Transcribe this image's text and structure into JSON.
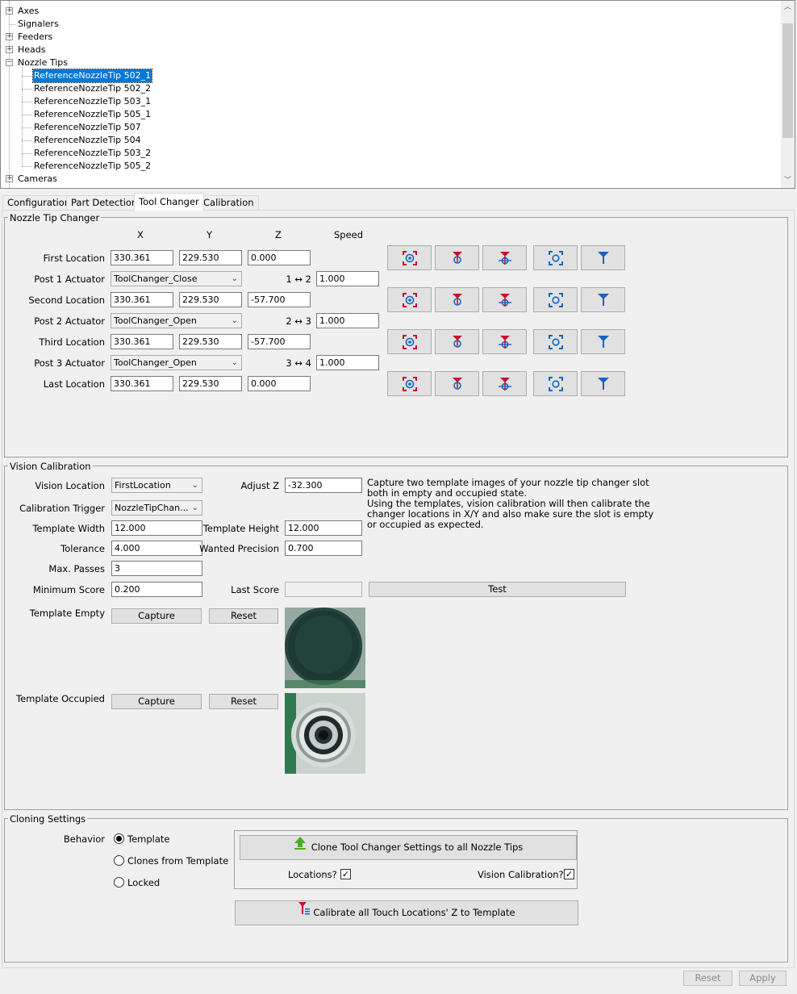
{
  "tree": {
    "items": [
      {
        "label": "Axes",
        "expander": "+"
      },
      {
        "label": "Signalers",
        "expander": ""
      },
      {
        "label": "Feeders",
        "expander": "+"
      },
      {
        "label": "Heads",
        "expander": "+"
      },
      {
        "label": "Nozzle Tips",
        "expander": "−"
      },
      {
        "label": "ReferenceNozzleTip 502_1",
        "expander": "",
        "selected": true
      },
      {
        "label": "ReferenceNozzleTip 502_2",
        "expander": ""
      },
      {
        "label": "ReferenceNozzleTip 503_1",
        "expander": ""
      },
      {
        "label": "ReferenceNozzleTip 505_1",
        "expander": ""
      },
      {
        "label": "ReferenceNozzleTip 507",
        "expander": ""
      },
      {
        "label": "ReferenceNozzleTip 504",
        "expander": ""
      },
      {
        "label": "ReferenceNozzleTip 503_2",
        "expander": ""
      },
      {
        "label": "ReferenceNozzleTip 505_2",
        "expander": ""
      },
      {
        "label": "Cameras",
        "expander": "+"
      }
    ]
  },
  "tabs": [
    {
      "label": "Configuration"
    },
    {
      "label": "Part Detection"
    },
    {
      "label": "Tool Changer",
      "active": true
    },
    {
      "label": "Calibration"
    }
  ],
  "changer": {
    "title": "Nozzle Tip Changer",
    "col_x": "X",
    "col_y": "Y",
    "col_z": "Z",
    "col_speed": "Speed",
    "rows": {
      "first": {
        "label": "First Location",
        "x": "330.361",
        "y": "229.530",
        "z": "0.000"
      },
      "post1": {
        "label": "Post 1 Actuator",
        "actuator": "ToolChanger_Close",
        "speed_label": "1 ↔ 2",
        "speed": "1.000"
      },
      "second": {
        "label": "Second Location",
        "x": "330.361",
        "y": "229.530",
        "z": "-57.700"
      },
      "post2": {
        "label": "Post 2 Actuator",
        "actuator": "ToolChanger_Open",
        "speed_label": "2 ↔ 3",
        "speed": "1.000"
      },
      "third": {
        "label": "Third Location",
        "x": "330.361",
        "y": "229.530",
        "z": "-57.700"
      },
      "post3": {
        "label": "Post 3 Actuator",
        "actuator": "ToolChanger_Open",
        "speed_label": "3 ↔ 4",
        "speed": "1.000"
      },
      "last": {
        "label": "Last Location",
        "x": "330.361",
        "y": "229.530",
        "z": "0.000"
      }
    }
  },
  "vision": {
    "title": "Vision Calibration",
    "vision_location_label": "Vision Location",
    "vision_location": "FirstLocation",
    "adjust_z_label": "Adjust Z",
    "adjust_z": "-32.300",
    "calibration_trigger_label": "Calibration Trigger",
    "calibration_trigger": "NozzleTipChan...",
    "template_width_label": "Template Width",
    "template_width": "12.000",
    "template_height_label": "Template Height",
    "template_height": "12.000",
    "tolerance_label": "Tolerance",
    "tolerance": "4.000",
    "wanted_precision_label": "Wanted Precision",
    "wanted_precision": "0.700",
    "max_passes_label": "Max. Passes",
    "max_passes": "3",
    "minimum_score_label": "Minimum Score",
    "minimum_score": "0.200",
    "last_score_label": "Last Score",
    "last_score": "",
    "test_label": "Test",
    "description_lines": [
      "Capture two template images of your nozzle tip changer slot",
      "both in empty and occupied state.",
      "Using the templates, vision calibration will then calibrate the",
      "changer locations in X/Y and also make sure the slot is empty",
      "or occupied as expected."
    ],
    "template_empty_label": "Template Empty",
    "template_occupied_label": "Template Occupied",
    "capture_label": "Capture",
    "reset_label": "Reset"
  },
  "cloning": {
    "title": "Cloning Settings",
    "behavior_label": "Behavior",
    "options": [
      {
        "label": "Template",
        "selected": true
      },
      {
        "label": "Clones from Template",
        "selected": false
      },
      {
        "label": "Locked",
        "selected": false
      }
    ],
    "clone_button": "Clone Tool Changer Settings to all Nozzle Tips",
    "locations_label": "Locations?",
    "locations_checked": true,
    "vision_cal_label": "Vision Calibration?",
    "vision_cal_checked": true,
    "calibrate_button": "Calibrate all Touch Locations' Z to Template"
  },
  "footer": {
    "reset_label": "Reset",
    "apply_label": "Apply"
  },
  "colors": {
    "selection": "#0078d7",
    "icon_red": "#c8102e",
    "icon_blue": "#1565c0",
    "clone_arrow": "#4caf22"
  }
}
